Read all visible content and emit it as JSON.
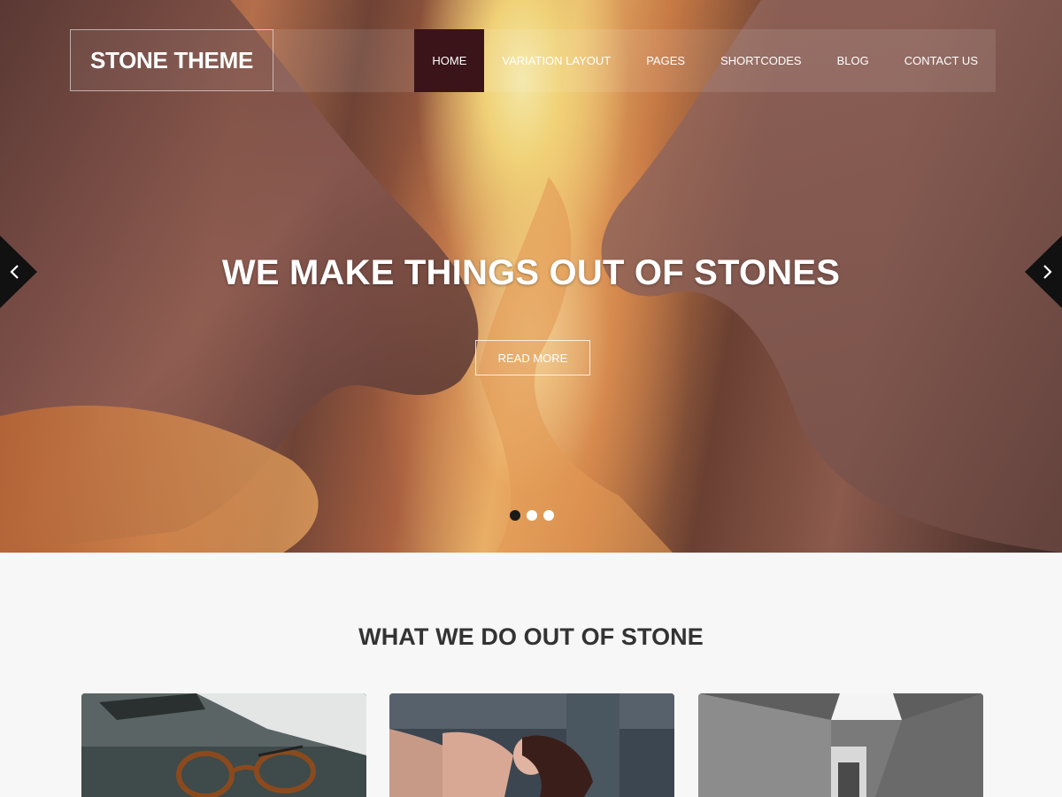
{
  "header": {
    "logo": "STONE THEME",
    "nav": [
      {
        "label": "HOME",
        "active": true
      },
      {
        "label": "VARIATION LAYOUT",
        "active": false
      },
      {
        "label": "PAGES",
        "active": false
      },
      {
        "label": "SHORTCODES",
        "active": false
      },
      {
        "label": "BLOG",
        "active": false
      },
      {
        "label": "CONTACT US",
        "active": false
      }
    ]
  },
  "slider": {
    "title": "WE MAKE THINGS OUT OF STONES",
    "button": "READ MORE",
    "prev_icon": "chevron-left-icon",
    "next_icon": "chevron-right-icon",
    "slides_count": 3,
    "active_slide": 1
  },
  "services": {
    "title": "WHAT WE DO OUT OF STONE"
  },
  "colors": {
    "nav_active": "#3a1418",
    "section_bg": "#f7f7f7",
    "title_text": "#333333"
  }
}
